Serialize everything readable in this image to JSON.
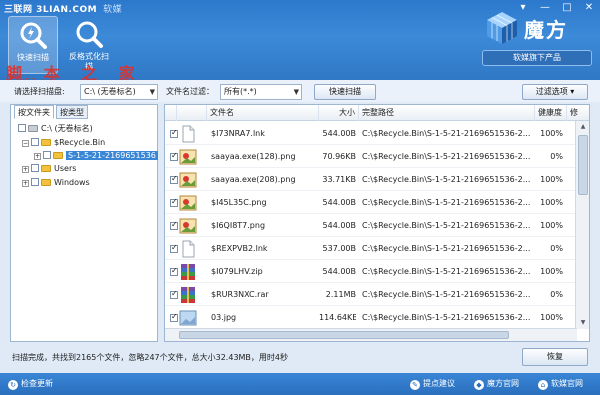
{
  "window": {
    "title": "三联网 3LIAN.COM",
    "title_suffix": "软媒",
    "controls": [
      "▾",
      "—",
      "□",
      "✕"
    ]
  },
  "toolbar": {
    "quick_scan_label": "快速扫描",
    "format_scan_label": "反格式化扫描"
  },
  "brand": {
    "name": "魔方",
    "tagline": "软媒旗下产品"
  },
  "watermark": {
    "text": "脚 本 之 家",
    "url": "jb51.net"
  },
  "filter": {
    "scan_target_label": "请选择扫描盘:",
    "drive_value": "C:\\ (无卷标名)",
    "filename_filter_label": "文件名过滤：",
    "filename_filter_value": "所有(*.*)",
    "quick_scan_button": "快速扫描",
    "filter_options_button": "过滤选项"
  },
  "tree": {
    "tabs": [
      "按文件夹",
      "按类型"
    ],
    "nodes": [
      {
        "label": "C:\\ (无卷标名)",
        "checked": false
      },
      {
        "label": "$Recycle.Bin",
        "checked": false
      },
      {
        "label": "S-1-5-21-2169651536",
        "checked": false,
        "selected": true
      },
      {
        "label": "Users",
        "checked": false
      },
      {
        "label": "Windows",
        "checked": false
      }
    ]
  },
  "table": {
    "columns": [
      "文件名",
      "大小",
      "完整路径",
      "健康度",
      "修"
    ],
    "rows": [
      {
        "name": "$I73NRA7.lnk",
        "size": "544.00B",
        "path": "C:\\$Recycle.Bin\\S-1-5-21-2169651536-2...",
        "health": "100%",
        "icon": "doc"
      },
      {
        "name": "saayaa.exe(128).png",
        "size": "70.96KB",
        "path": "C:\\$Recycle.Bin\\S-1-5-21-2169651536-2...",
        "health": "0%",
        "icon": "img"
      },
      {
        "name": "saayaa.exe(208).png",
        "size": "33.71KB",
        "path": "C:\\$Recycle.Bin\\S-1-5-21-2169651536-2...",
        "health": "100%",
        "icon": "img"
      },
      {
        "name": "$I45L35C.png",
        "size": "544.00B",
        "path": "C:\\$Recycle.Bin\\S-1-5-21-2169651536-2...",
        "health": "100%",
        "icon": "img"
      },
      {
        "name": "$I6QI8T7.png",
        "size": "544.00B",
        "path": "C:\\$Recycle.Bin\\S-1-5-21-2169651536-2...",
        "health": "100%",
        "icon": "img"
      },
      {
        "name": "$REXPVB2.lnk",
        "size": "537.00B",
        "path": "C:\\$Recycle.Bin\\S-1-5-21-2169651536-2...",
        "health": "0%",
        "icon": "doc"
      },
      {
        "name": "$I079LHV.zip",
        "size": "544.00B",
        "path": "C:\\$Recycle.Bin\\S-1-5-21-2169651536-2...",
        "health": "100%",
        "icon": "zip"
      },
      {
        "name": "$RUR3NXC.rar",
        "size": "2.11MB",
        "path": "C:\\$Recycle.Bin\\S-1-5-21-2169651536-2...",
        "health": "0%",
        "icon": "zip"
      },
      {
        "name": "03.jpg",
        "size": "114.64KB",
        "path": "C:\\$Recycle.Bin\\S-1-5-21-2169651536-2...",
        "health": "100%",
        "icon": "jpg"
      }
    ]
  },
  "status": {
    "summary": "扫描完成，共找到2165个文件，忽略247个文件，总大小32.43MB，用时4秒",
    "restore_button": "恢复"
  },
  "footer": {
    "check_update": "检查更新",
    "feedback": "提点建议",
    "mofang_site": "魔方官网",
    "ruanmei_site": "软媒官网"
  },
  "colors": {
    "accent": "#2f7ccd",
    "footer": "#2a6fbd",
    "selection": "#3a86d6"
  }
}
